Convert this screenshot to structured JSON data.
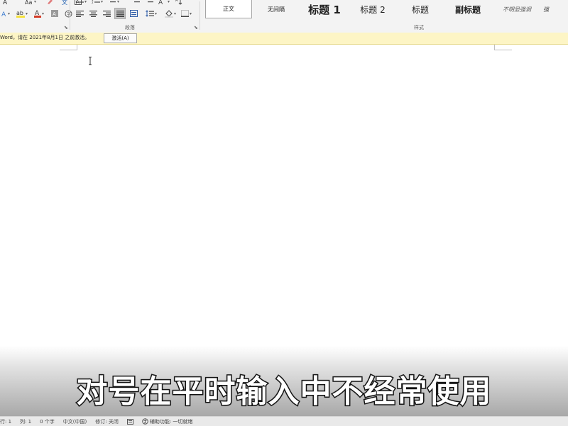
{
  "ribbon": {
    "groups": {
      "paragraph_label": "段落",
      "styles_label": "样式"
    },
    "styles": [
      {
        "label": "正文",
        "selected": true
      },
      {
        "label": "无间隔",
        "selected": false
      },
      {
        "label": "标题 1",
        "selected": false
      },
      {
        "label": "标题 2",
        "selected": false
      },
      {
        "label": "标题",
        "selected": false
      },
      {
        "label": "副标题",
        "selected": false
      },
      {
        "label": "不明显强调",
        "selected": false
      },
      {
        "label": "强",
        "selected": false
      }
    ],
    "icons": {
      "font_color_accent": "#d23a26",
      "highlight_accent": "#f4e03a",
      "underline_accent": "#d23a26"
    }
  },
  "message_bar": {
    "text": "Word，请在 2021年8月1日 之前激活。",
    "button_label": "激活(A)",
    "background": "#fdf5c5"
  },
  "subtitle": {
    "text": "对号在平时输入中不经常使用"
  },
  "status_bar": {
    "items": [
      "行: 1",
      "列: 1",
      "0 个字",
      "中文(中国)",
      "修订: 关闭",
      "",
      "辅助功能: 一切就绪"
    ]
  }
}
